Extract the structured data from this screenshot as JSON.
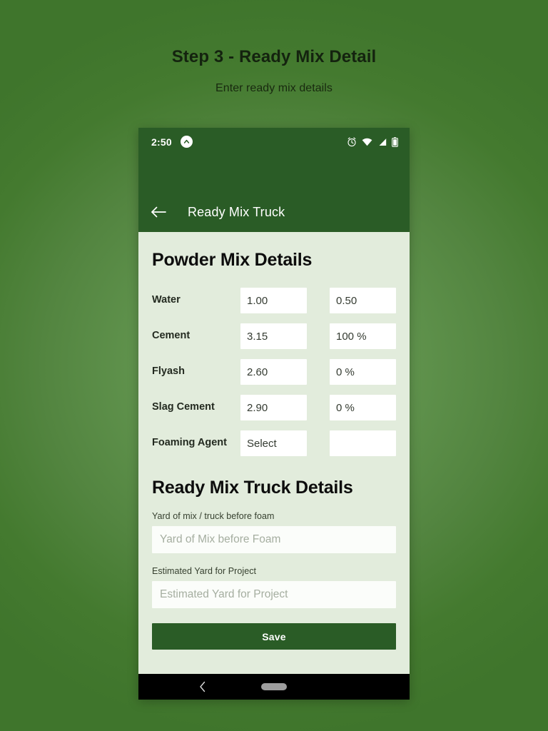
{
  "page": {
    "title": "Step 3 - Ready Mix Detail",
    "subtitle": "Enter ready mix details"
  },
  "phone": {
    "status_bar": {
      "time": "2:50",
      "left_icon": "caret-up-circle-icon",
      "right_icons": [
        "alarm-icon",
        "wifi-icon",
        "signal-icon",
        "battery-icon"
      ]
    },
    "app_bar": {
      "back_icon": "back-arrow-icon",
      "title": "Ready Mix Truck"
    },
    "nav_bar": {
      "back_icon": "nav-back-icon",
      "home_indicator": "home-pill"
    }
  },
  "powder_section": {
    "heading": "Powder Mix Details",
    "rows": [
      {
        "label": "Water",
        "value": "1.00",
        "secondary": "0.50"
      },
      {
        "label": "Cement",
        "value": "3.15",
        "secondary": "100 %"
      },
      {
        "label": "Flyash",
        "value": "2.60",
        "secondary": "0 %"
      },
      {
        "label": "Slag Cement",
        "value": "2.90",
        "secondary": "0 %"
      },
      {
        "label": "Foaming Agent",
        "value": "Select",
        "secondary": ""
      }
    ]
  },
  "truck_section": {
    "heading": "Ready Mix Truck Details",
    "fields": [
      {
        "label": "Yard of mix / truck before foam",
        "placeholder": "Yard of Mix before Foam",
        "value": ""
      },
      {
        "label": "Estimated Yard for Project",
        "placeholder": "Estimated Yard for Project",
        "value": ""
      }
    ],
    "save_label": "Save"
  },
  "colors": {
    "brand_green": "#2a5c26",
    "content_bg": "#e2ecdc",
    "backdrop_green": "#639650"
  }
}
